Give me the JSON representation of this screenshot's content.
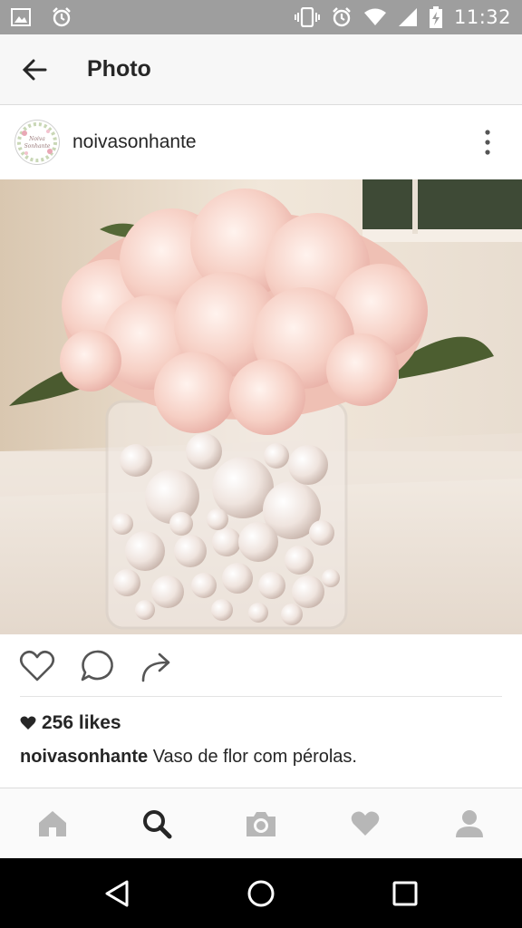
{
  "status_bar": {
    "time": "11:32",
    "icons": [
      "image-icon",
      "alarm-icon",
      "vibrate-icon",
      "alarm-icon",
      "wifi-icon",
      "signal-icon",
      "battery-charging-icon"
    ]
  },
  "app_bar": {
    "title": "Photo",
    "back_icon": "arrow-left-icon"
  },
  "post": {
    "username": "noivasonhante",
    "avatar_text": "Noiva Sonhante",
    "more_icon": "more-vertical-icon",
    "photo_subject": "pink hydrangea in glass vase filled with pearls",
    "actions": [
      "heart-icon",
      "comment-icon",
      "share-icon"
    ],
    "likes": "256 likes",
    "caption_user": "noivasonhante",
    "caption_text": " Vaso de flor com pérolas."
  },
  "tab_bar": {
    "tabs": [
      "home-icon",
      "search-icon",
      "camera-icon",
      "heart-icon",
      "profile-icon"
    ],
    "active": "search-icon"
  },
  "nav_bar": {
    "buttons": [
      "back-triangle-icon",
      "home-circle-icon",
      "recents-square-icon"
    ]
  },
  "colors": {
    "status_bar": "#9e9e9e",
    "text": "#262626",
    "inactive_tab": "#b7b7b7",
    "active_tab": "#262626"
  }
}
